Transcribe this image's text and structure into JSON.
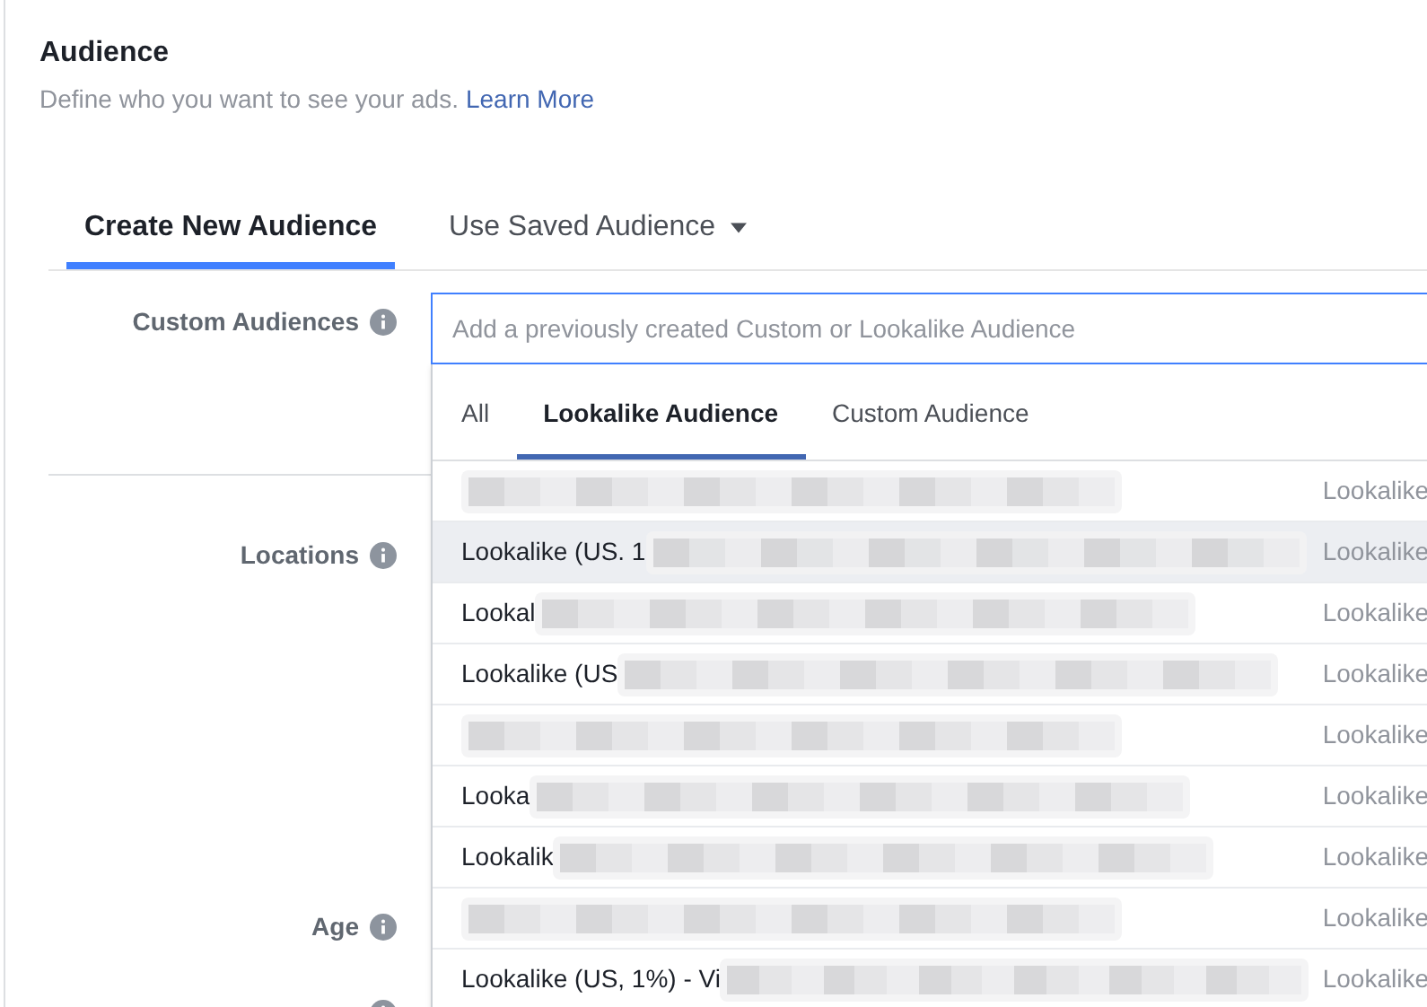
{
  "header": {
    "title": "Audience",
    "description": "Define who you want to see your ads.",
    "link": "Learn More"
  },
  "tabs": [
    {
      "label": "Create New Audience",
      "selected": true,
      "dropdown": false
    },
    {
      "label": "Use Saved Audience",
      "selected": false,
      "dropdown": true
    }
  ],
  "fields": [
    {
      "label": "Custom Audiences"
    },
    {
      "label": "Locations"
    },
    {
      "label": "Age"
    }
  ],
  "search": {
    "placeholder": "Add a previously created Custom or Lookalike Audience"
  },
  "dropdown": {
    "tabs": [
      {
        "label": "All",
        "selected": false
      },
      {
        "label": "Lookalike Audience",
        "selected": true
      },
      {
        "label": "Custom Audience",
        "selected": false
      }
    ],
    "rows": [
      {
        "redacted": true,
        "type": "Lookalike",
        "highlighted": false
      },
      {
        "name": "Lookalike (US. 1",
        "redacted": true,
        "type": "Lookalike",
        "highlighted": true
      },
      {
        "name": "Lookal",
        "redacted": true,
        "type": "Lookalike",
        "highlighted": false
      },
      {
        "name": "Lookalike (US",
        "redacted": true,
        "type": "Lookalike",
        "highlighted": false
      },
      {
        "redacted": true,
        "type": "Lookalike",
        "highlighted": false
      },
      {
        "name": "Looka",
        "redacted": true,
        "type": "Lookalike",
        "highlighted": false
      },
      {
        "name": "Lookalik",
        "redacted": true,
        "type": "Lookalike",
        "highlighted": false
      },
      {
        "redacted": true,
        "type": "Lookalike",
        "highlighted": false
      },
      {
        "name": "Lookalike (US, 1%) - Vi",
        "redacted": true,
        "type": "Lookalike",
        "highlighted": false
      }
    ]
  }
}
